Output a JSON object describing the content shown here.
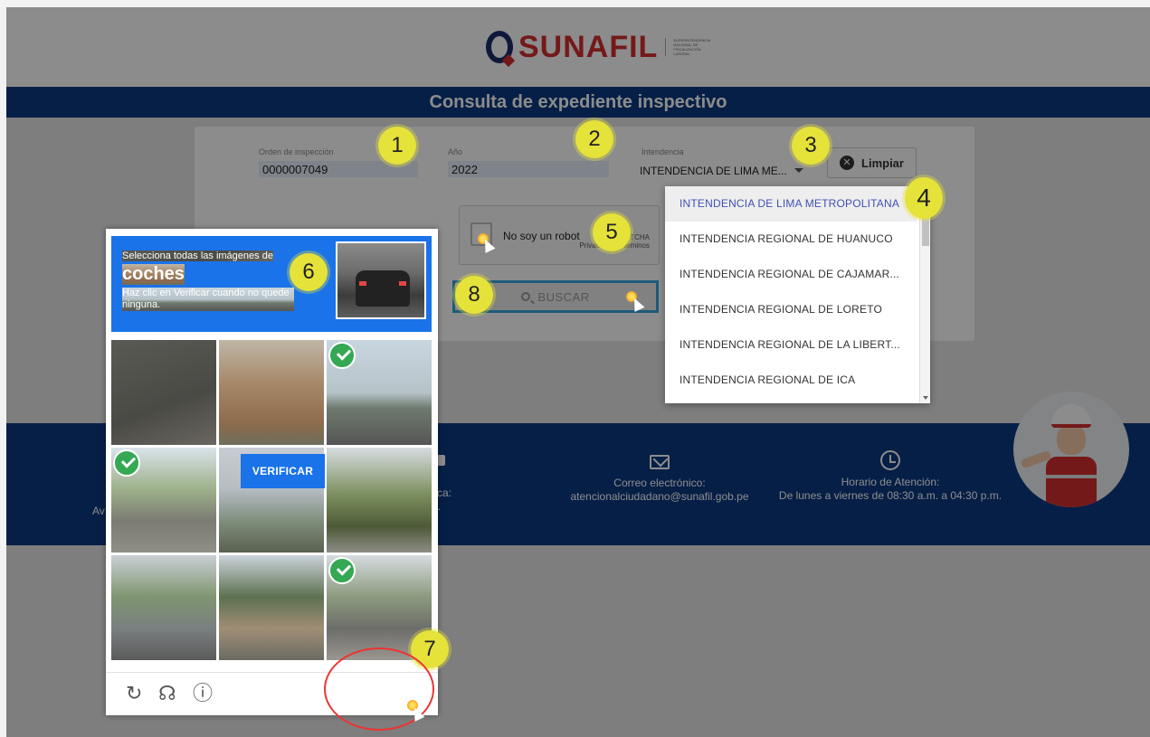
{
  "logo": {
    "brand": "SUNAFIL",
    "subtitle": "SUPERINTENDENCIA NACIONAL DE FISCALIZACIÓN LABORAL"
  },
  "page_title": "Consulta de expediente inspectivo",
  "form": {
    "orden": {
      "label": "Orden de inspección",
      "value": "0000007049"
    },
    "anio": {
      "label": "Año",
      "value": "2022"
    },
    "intendencia": {
      "label": "Intendencia",
      "value": "INTENDENCIA DE LIMA ME..."
    },
    "limpiar_label": "Limpiar",
    "buscar_label": "BUSCAR"
  },
  "recaptcha": {
    "label": "No soy un robot",
    "brand": "reCAPTCHA",
    "privacy": "Privacidad - Términos"
  },
  "dropdown": {
    "options": [
      "INTENDENCIA DE LIMA METROPOLITANA",
      "INTENDENCIA REGIONAL DE HUANUCO",
      "INTENDENCIA REGIONAL DE CAJAMAR...",
      "INTENDENCIA REGIONAL DE LORETO",
      "INTENDENCIA REGIONAL DE LA LIBERT...",
      "INTENDENCIA REGIONAL DE ICA"
    ]
  },
  "challenge": {
    "instruction": "Selecciona todas las imágenes de",
    "target": "coches",
    "hint": "Haz clic en Verificar cuando no quede ninguna.",
    "verify_label": "VERIFICAR",
    "selected": [
      false,
      false,
      true,
      true,
      false,
      false,
      false,
      false,
      true
    ]
  },
  "footer": {
    "address_fragment": "Av",
    "phone_label": "efónica:",
    "phone_value": "2800.",
    "email_label": "Correo electrónico:",
    "email_value": "atencionalciudadano@sunafil.gob.pe",
    "hours_label": "Horario de Atención:",
    "hours_value": "De lunes a viernes de 08:30 a.m. a 04:30 p.m."
  },
  "badges": [
    "1",
    "2",
    "3",
    "4",
    "5",
    "6",
    "7",
    "8"
  ],
  "colors": {
    "navy": "#0b3a82",
    "brand_red": "#d42e2e",
    "recaptcha_blue": "#1a73e8",
    "badge_yellow": "#e5e23a",
    "check_green": "#34a853"
  }
}
